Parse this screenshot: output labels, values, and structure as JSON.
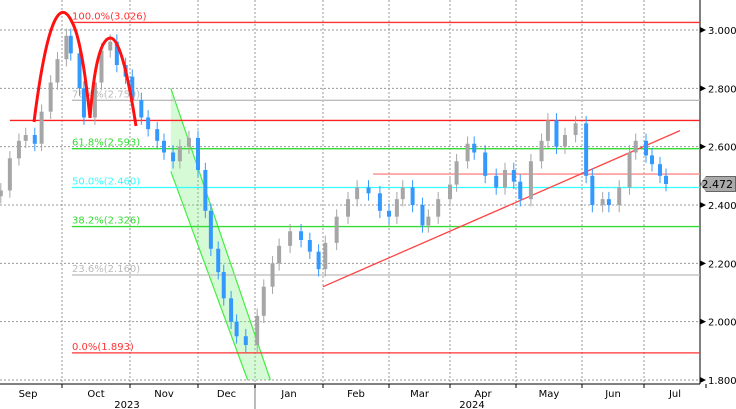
{
  "chart_data": {
    "type": "candlestick",
    "title": "",
    "ylim": [
      1.78,
      3.1
    ],
    "y_ticks": [
      "3.000",
      "2.800",
      "2.600",
      "2.400",
      "2.200",
      "2.000",
      "1.800"
    ],
    "x_months": [
      {
        "label": "Sep",
        "date": "2023-09-01"
      },
      {
        "label": "Oct",
        "date": "2023-10-01"
      },
      {
        "label": "Nov",
        "date": "2023-11-01"
      },
      {
        "label": "Dec",
        "date": "2023-12-01"
      },
      {
        "label": "Jan",
        "date": "2024-01-01"
      },
      {
        "label": "Feb",
        "date": "2024-02-01"
      },
      {
        "label": "Mar",
        "date": "2024-03-01"
      },
      {
        "label": "Apr",
        "date": "2024-04-01"
      },
      {
        "label": "May",
        "date": "2024-05-01"
      },
      {
        "label": "Jun",
        "date": "2024-06-01"
      },
      {
        "label": "Jul",
        "date": "2024-07-01"
      }
    ],
    "years": [
      {
        "label": "2023"
      },
      {
        "label": "2024"
      }
    ],
    "last_price": "2.472",
    "colors": {
      "up": "#a6a6a6",
      "down": "#3399ff",
      "fib_red": "#ff3333",
      "fib_green": "#33dd33",
      "fib_cyan": "#33ffff",
      "fib_gray": "#bbbbbb"
    },
    "series": [
      [
        "2023-09-04",
        2.45
      ],
      [
        "2023-09-08",
        2.56
      ],
      [
        "2023-09-12",
        2.62
      ],
      [
        "2023-09-15",
        2.64
      ],
      [
        "2023-09-19",
        2.61
      ],
      [
        "2023-09-22",
        2.72
      ],
      [
        "2023-09-26",
        2.82
      ],
      [
        "2023-09-29",
        2.9
      ],
      [
        "2023-10-03",
        2.98
      ],
      [
        "2023-10-05",
        2.92
      ],
      [
        "2023-10-09",
        2.8
      ],
      [
        "2023-10-11",
        2.7
      ],
      [
        "2023-10-16",
        2.82
      ],
      [
        "2023-10-19",
        2.93
      ],
      [
        "2023-10-23",
        2.96
      ],
      [
        "2023-10-26",
        2.88
      ],
      [
        "2023-10-30",
        2.84
      ],
      [
        "2023-11-02",
        2.76
      ],
      [
        "2023-11-06",
        2.7
      ],
      [
        "2023-11-09",
        2.66
      ],
      [
        "2023-11-13",
        2.62
      ],
      [
        "2023-11-16",
        2.58
      ],
      [
        "2023-11-20",
        2.55
      ],
      [
        "2023-11-23",
        2.6
      ],
      [
        "2023-11-27",
        2.63
      ],
      [
        "2023-12-01",
        2.52
      ],
      [
        "2023-12-05",
        2.38
      ],
      [
        "2023-12-08",
        2.25
      ],
      [
        "2023-12-12",
        2.17
      ],
      [
        "2023-12-15",
        2.08
      ],
      [
        "2023-12-19",
        2.0
      ],
      [
        "2023-12-22",
        1.95
      ],
      [
        "2023-12-27",
        1.92
      ],
      [
        "2024-01-02",
        2.02
      ],
      [
        "2024-01-05",
        2.12
      ],
      [
        "2024-01-09",
        2.2
      ],
      [
        "2024-01-12",
        2.26
      ],
      [
        "2024-01-17",
        2.31
      ],
      [
        "2024-01-22",
        2.28
      ],
      [
        "2024-01-26",
        2.24
      ],
      [
        "2024-01-30",
        2.18
      ],
      [
        "2024-02-02",
        2.27
      ],
      [
        "2024-02-07",
        2.36
      ],
      [
        "2024-02-12",
        2.42
      ],
      [
        "2024-02-16",
        2.46
      ],
      [
        "2024-02-21",
        2.44
      ],
      [
        "2024-02-26",
        2.38
      ],
      [
        "2024-03-01",
        2.36
      ],
      [
        "2024-03-05",
        2.42
      ],
      [
        "2024-03-08",
        2.46
      ],
      [
        "2024-03-13",
        2.4
      ],
      [
        "2024-03-18",
        2.33
      ],
      [
        "2024-03-21",
        2.36
      ],
      [
        "2024-03-26",
        2.42
      ],
      [
        "2024-04-01",
        2.47
      ],
      [
        "2024-04-04",
        2.55
      ],
      [
        "2024-04-09",
        2.61
      ],
      [
        "2024-04-12",
        2.58
      ],
      [
        "2024-04-17",
        2.5
      ],
      [
        "2024-04-22",
        2.46
      ],
      [
        "2024-04-26",
        2.52
      ],
      [
        "2024-04-30",
        2.48
      ],
      [
        "2024-05-03",
        2.42
      ],
      [
        "2024-05-08",
        2.55
      ],
      [
        "2024-05-13",
        2.62
      ],
      [
        "2024-05-16",
        2.69
      ],
      [
        "2024-05-20",
        2.6
      ],
      [
        "2024-05-24",
        2.64
      ],
      [
        "2024-05-29",
        2.68
      ],
      [
        "2024-06-03",
        2.5
      ],
      [
        "2024-06-06",
        2.4
      ],
      [
        "2024-06-11",
        2.42
      ],
      [
        "2024-06-14",
        2.4
      ],
      [
        "2024-06-19",
        2.46
      ],
      [
        "2024-06-24",
        2.58
      ],
      [
        "2024-06-27",
        2.62
      ],
      [
        "2024-07-02",
        2.57
      ],
      [
        "2024-07-05",
        2.54
      ],
      [
        "2024-07-09",
        2.5
      ],
      [
        "2024-07-12",
        2.472
      ]
    ],
    "fib_levels": [
      {
        "label": "100.0%(3.026)",
        "value": 3.026,
        "color": "#ff3333"
      },
      {
        "label": "76.4%(2.759)",
        "value": 2.759,
        "color": "#bbbbbb"
      },
      {
        "label": "61.8%(2.593)",
        "value": 2.593,
        "color": "#33dd33"
      },
      {
        "label": "50.0%(2.460)",
        "value": 2.46,
        "color": "#33ffff"
      },
      {
        "label": "38.2%(2.326)",
        "value": 2.326,
        "color": "#33dd33"
      },
      {
        "label": "23.6%(2.160)",
        "value": 2.16,
        "color": "#bbbbbb"
      },
      {
        "label": "0.0%(1.893)",
        "value": 1.893,
        "color": "#ff3333"
      }
    ],
    "horizontal_lines": [
      {
        "value": 2.69,
        "from": "2023-09-08",
        "color": "#ff2222"
      },
      {
        "value": 2.506,
        "from": "2024-02-23",
        "color": "#ff8888"
      }
    ],
    "trendline": {
      "from": [
        "2024-02-01",
        2.12
      ],
      "to": [
        "2024-07-19",
        2.655
      ],
      "color": "#ff4444"
    },
    "channel": {
      "start": "2023-11-19",
      "upper": [
        2.8,
        1.8
      ],
      "lower": [
        2.515,
        1.8
      ],
      "end_upper": "2024-01-08",
      "end_lower": "2023-12-28"
    }
  }
}
